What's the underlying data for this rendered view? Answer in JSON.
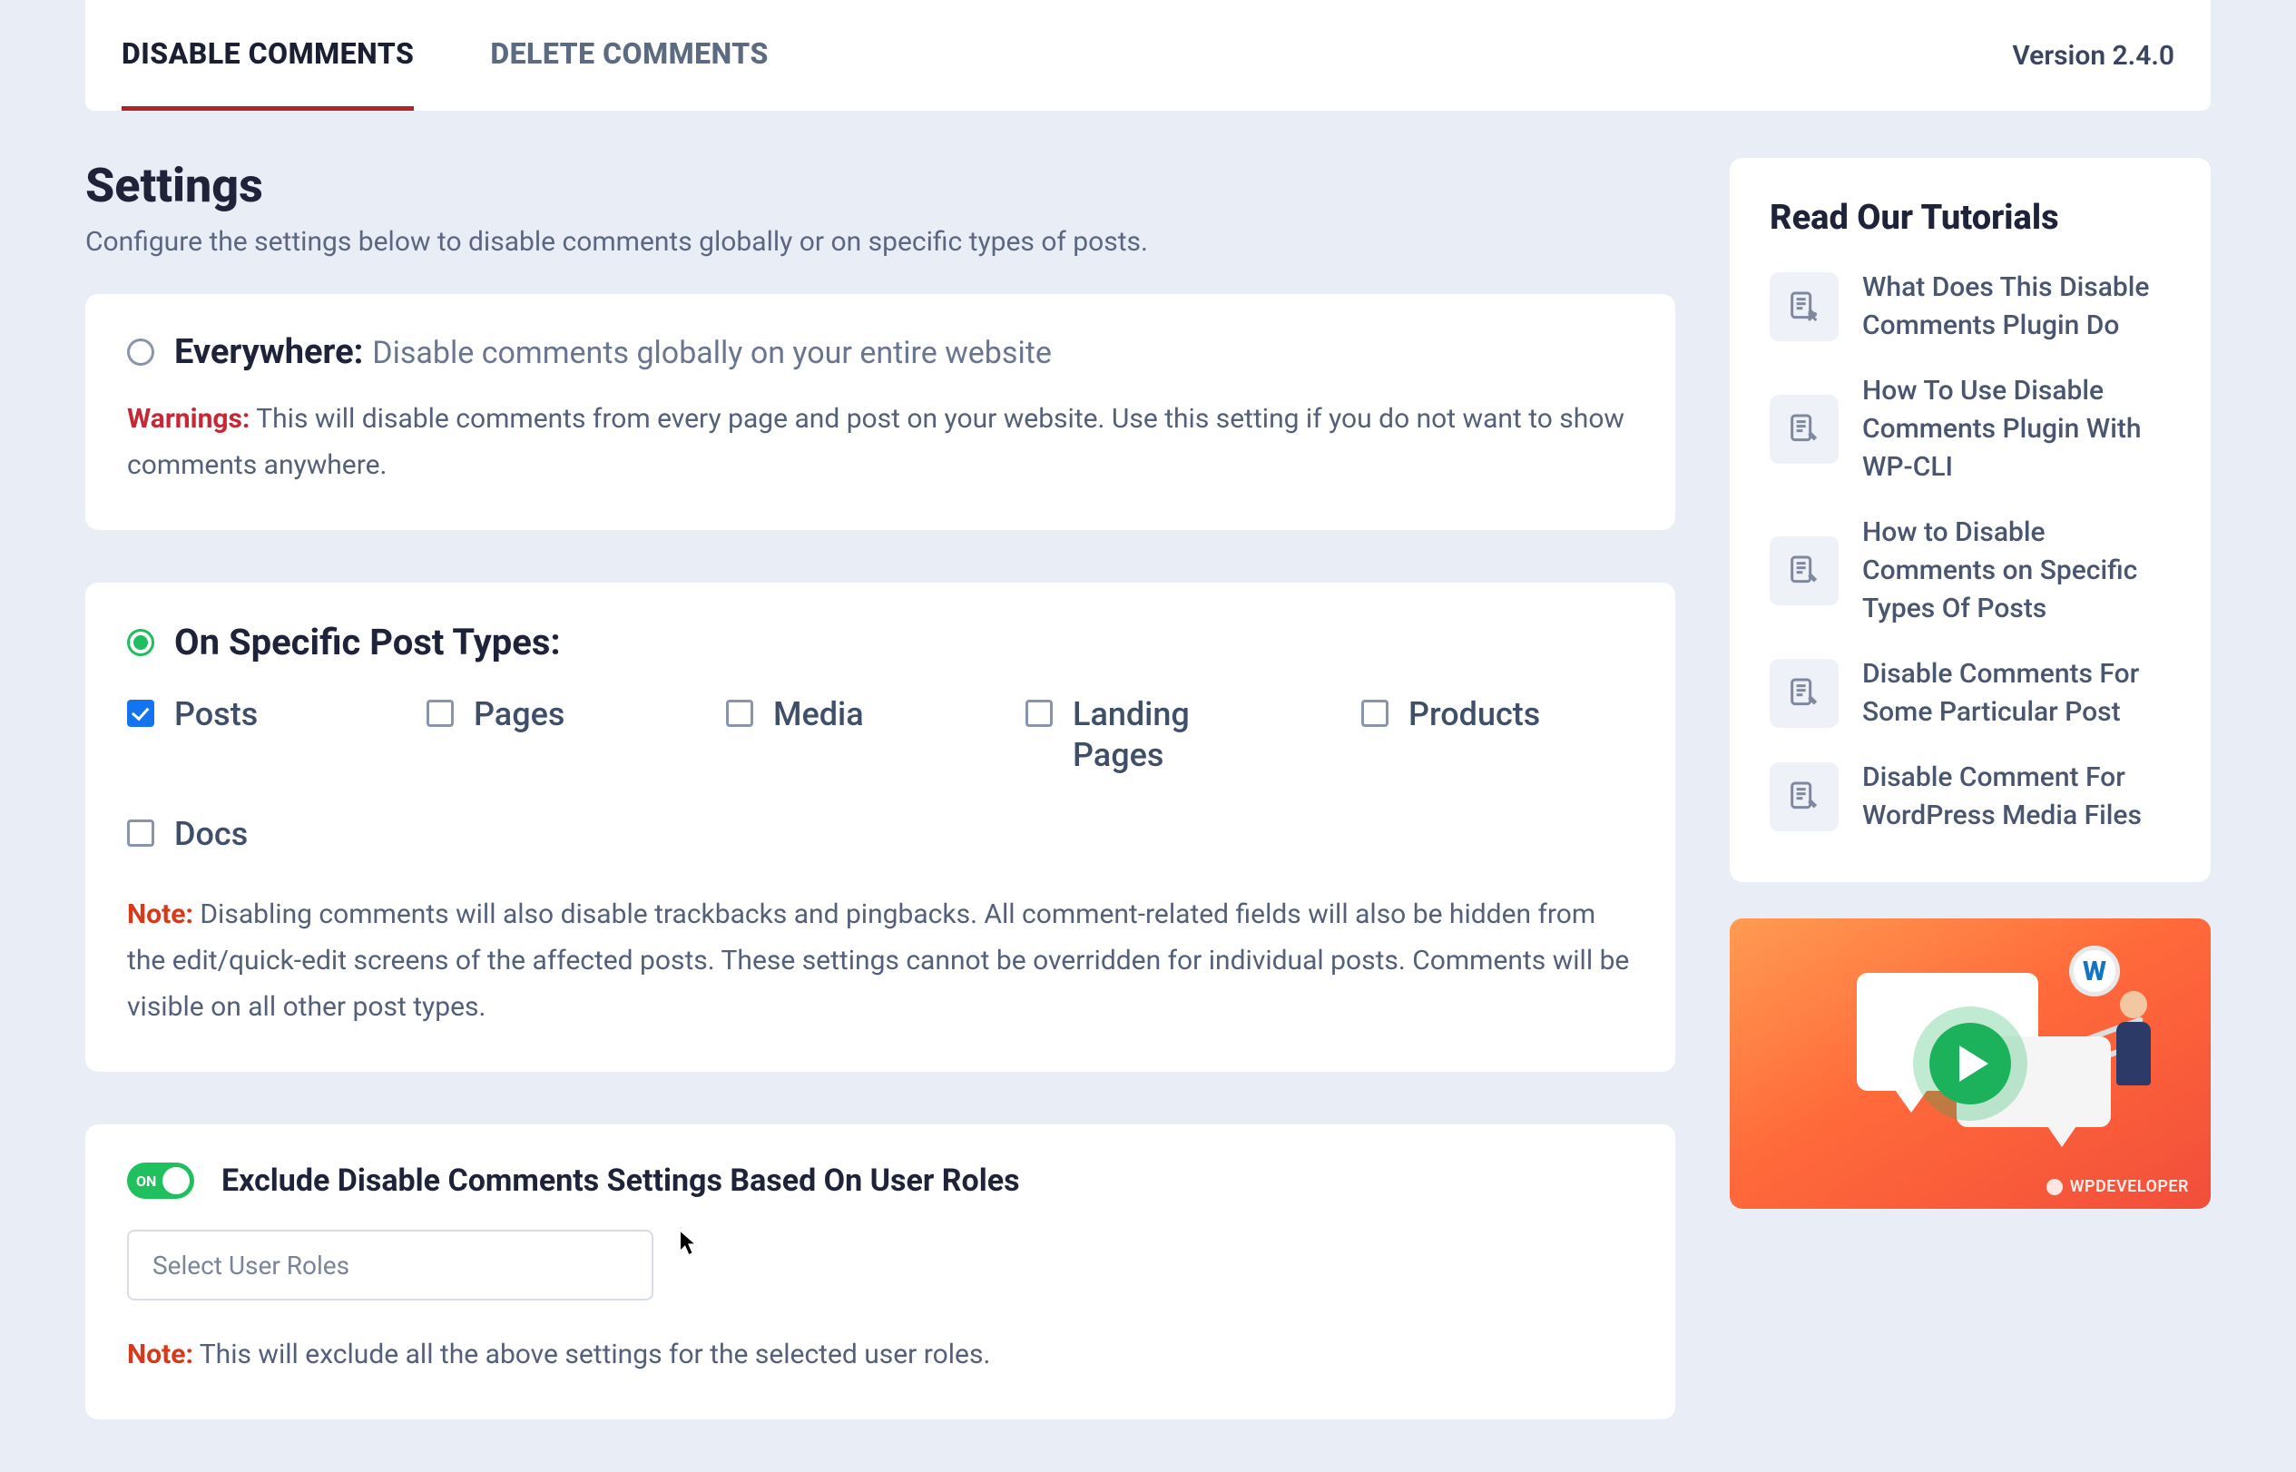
{
  "tabs": {
    "disable": "DISABLE COMMENTS",
    "delete": "DELETE COMMENTS"
  },
  "version": "Version 2.4.0",
  "page": {
    "title": "Settings",
    "subtitle": "Configure the settings below to disable comments globally or on specific types of posts."
  },
  "option_everywhere": {
    "label": "Everywhere:",
    "desc": "Disable comments globally on your entire website",
    "warn_tag": "Warnings:",
    "warn_text": "This will disable comments from every page and post on your website. Use this setting if you do not want to show comments anywhere."
  },
  "option_specific": {
    "label": "On Specific Post Types:",
    "post_types": {
      "posts": "Posts",
      "pages": "Pages",
      "media": "Media",
      "landing": "Landing Pages",
      "products": "Products",
      "docs": "Docs"
    },
    "note_tag": "Note:",
    "note_text": "Disabling comments will also disable trackbacks and pingbacks. All comment-related fields will also be hidden from the edit/quick-edit screens of the affected posts. These settings cannot be overridden for individual posts. Comments will be visible on all other post types."
  },
  "exclude_roles": {
    "toggle_on": "ON",
    "label": "Exclude Disable Comments Settings Based On User Roles",
    "placeholder": "Select User Roles",
    "note_tag": "Note:",
    "note_text": "This will exclude all the above settings for the selected user roles."
  },
  "sidebar": {
    "title": "Read Our Tutorials",
    "tutorials": [
      "What Does This Disable Comments Plugin Do",
      "How To Use Disable Comments Plugin With WP-CLI",
      "How to Disable Comments on Specific Types Of Posts",
      "Disable Comments For Some Particular Post",
      "Disable Comment For WordPress Media Files"
    ],
    "wp_glyph": "W",
    "watermark": "WPDEVELOPER"
  }
}
